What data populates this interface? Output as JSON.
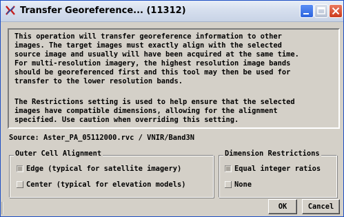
{
  "window": {
    "title": "Transfer Georeference... (11312)",
    "icons": [
      "app-icon",
      "minimize-icon",
      "maximize-icon",
      "close-icon"
    ]
  },
  "description": {
    "lines": [
      "This operation will transfer georeference information to other",
      " images.  The target images must exactly align with the selected",
      " source image and usually will have been acquired at the same time.",
      "  For multi-resolution imagery, the highest resolution image bands",
      " should be georeferenced first and this tool may then be used for",
      " transfer to the lower resolution bands.",
      "",
      "The Restrictions setting is used to help ensure that the selected",
      " images have compatible dimensions, allowing for the alignment",
      " specified.  Use caution when overriding this setting."
    ]
  },
  "source": {
    "text": "Source: Aster_PA_05112000.rvc / VNIR/Band3N"
  },
  "outer_cell_alignment": {
    "title": "Outer Cell Alignment",
    "options": [
      {
        "label": "Edge (typical for satellite imagery)",
        "selected": true
      },
      {
        "label": "Center (typical for elevation models)",
        "selected": false
      }
    ]
  },
  "dimension_restrictions": {
    "title": "Dimension Restrictions",
    "options": [
      {
        "label": "Equal integer ratios",
        "selected": true
      },
      {
        "label": "None",
        "selected": false
      }
    ]
  },
  "buttons": {
    "ok": "OK",
    "cancel": "Cancel"
  },
  "colors": {
    "dialog_bg": "#d4d0c8",
    "titlebar": "#d6dfee",
    "close_btn": "#cc3a1c",
    "min_btn": "#2c63de"
  }
}
